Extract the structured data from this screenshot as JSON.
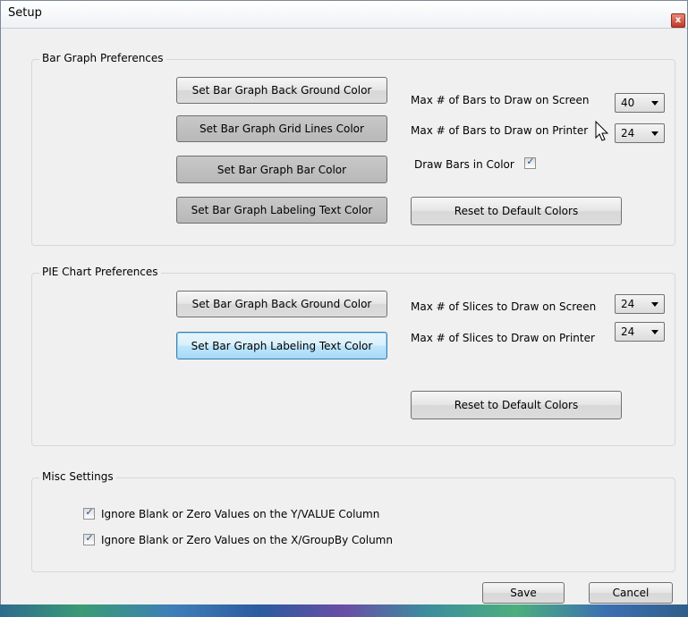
{
  "window": {
    "title": "Setup",
    "close_label": "x"
  },
  "bar_graph": {
    "title": "Bar Graph Preferences",
    "buttons": {
      "back_ground": "Set Bar Graph Back Ground Color",
      "grid_lines": "Set Bar Graph Grid Lines Color",
      "bar_color": "Set Bar Graph Bar Color",
      "labeling_text": "Set Bar Graph Labeling Text Color",
      "reset": "Reset to Default Colors"
    },
    "max_bars_screen_label": "Max # of Bars to Draw on Screen",
    "max_bars_screen_value": "40",
    "max_bars_printer_label": "Max # of Bars to Draw on Printer",
    "max_bars_printer_value": "24",
    "draw_in_color_label": "Draw Bars in Color",
    "draw_in_color_checked": true
  },
  "pie_chart": {
    "title": "PIE Chart Preferences",
    "buttons": {
      "back_ground": "Set Bar Graph Back Ground Color",
      "labeling_text": "Set Bar Graph Labeling Text Color",
      "reset": "Reset to Default Colors"
    },
    "max_slices_screen_label": "Max # of Slices to Draw on Screen",
    "max_slices_screen_value": "24",
    "max_slices_printer_label": "Max # of Slices to Draw on Printer",
    "max_slices_printer_value": "24"
  },
  "misc": {
    "title": "Misc Settings",
    "ignore_y_label": "Ignore Blank or Zero Values on the Y/VALUE Column",
    "ignore_y_checked": true,
    "ignore_x_label": "Ignore Blank or Zero Values on the X/GroupBy Column",
    "ignore_x_checked": true
  },
  "footer": {
    "save_label": "Save",
    "cancel_label": "Cancel"
  },
  "colors": {
    "focus_border": "#3c7fb1",
    "check_tick": "#1f4f8c",
    "close_button": "#c0392b"
  },
  "icons": {
    "check": "✓",
    "close": "x"
  }
}
